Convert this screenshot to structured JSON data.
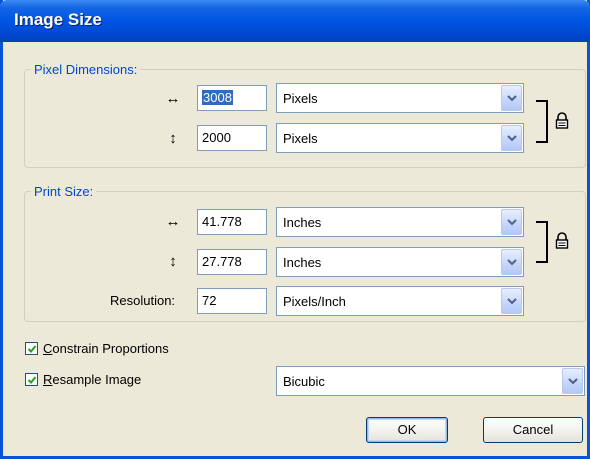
{
  "window": {
    "title": "Image Size"
  },
  "pixel_dimensions": {
    "legend": "Pixel Dimensions:",
    "width": {
      "value_selected": "3008",
      "unit": "Pixels"
    },
    "height": {
      "value": "2000",
      "unit": "Pixels"
    }
  },
  "print_size": {
    "legend": "Print Size:",
    "width": {
      "value": "41.778",
      "unit": "Inches"
    },
    "height": {
      "value": "27.778",
      "unit": "Inches"
    },
    "resolution": {
      "label": "Resolution:",
      "value": "72",
      "unit": "Pixels/Inch"
    }
  },
  "options": {
    "constrain": {
      "label_key": "C",
      "label_rest": "onstrain Proportions",
      "checked": true
    },
    "resample": {
      "label_key": "R",
      "label_rest": "esample Image",
      "checked": true,
      "method": "Bicubic"
    }
  },
  "buttons": {
    "ok": "OK",
    "cancel": "Cancel"
  },
  "icons": {
    "width_arrow": "↔",
    "height_arrow": "↕"
  }
}
